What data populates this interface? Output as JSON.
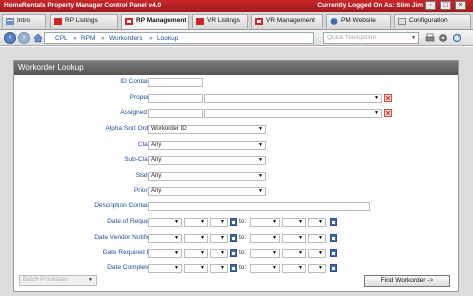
{
  "titlebar": {
    "title": "HomeRentals Property Manager Control Panel v4.0",
    "user": "Currently Logged On As: Slim Jim",
    "min": "-",
    "max": "□",
    "close": "×"
  },
  "tabs": [
    {
      "label": "Intro",
      "icon": "intro-icon",
      "active": false
    },
    {
      "label": "RP Listings",
      "icon": "listings-icon",
      "active": false
    },
    {
      "label": "RP Management",
      "icon": "management-icon",
      "active": true
    },
    {
      "label": "VR Listings",
      "icon": "listings-icon",
      "active": false
    },
    {
      "label": "VR Management",
      "icon": "management-icon",
      "active": false
    },
    {
      "label": "PM Website",
      "icon": "website-icon",
      "active": false
    },
    {
      "label": "Configuration",
      "icon": "config-icon",
      "active": false
    }
  ],
  "nav": {
    "back": "‹",
    "forward": "›",
    "breadcrumb": [
      "CPL",
      "RPM",
      "Workorders",
      "Lookup"
    ],
    "quick_nav_placeholder": "Quick Navigation"
  },
  "form": {
    "title": "Workorder Lookup",
    "id_label": "ID Contains:",
    "property_label": "Property:",
    "assigned_label": "Assigned to:",
    "alpha_sort_label": "Alpha Sort Order:",
    "alpha_sort_value": "Workorder ID",
    "class_label": "Class:",
    "class_value": "Any",
    "subclass_label": "Sub-Class:",
    "subclass_value": "Any",
    "status_label": "Status:",
    "status_value": "Any",
    "priority_label": "Priority:",
    "priority_value": "Any",
    "description_label": "Description Contains:",
    "date_request_label": "Date of Request:",
    "date_vendor_label": "Date Vendor Notified:",
    "date_required_label": "Date Required By:",
    "date_completed_label": "Date Completed:",
    "to_label": "to:",
    "batch_label": "Batch Processes",
    "find_button": "Find Workorder ->"
  },
  "colors": {
    "titlebar": "#b82126",
    "label": "#1b4f9b",
    "panel_header": "#666666"
  }
}
